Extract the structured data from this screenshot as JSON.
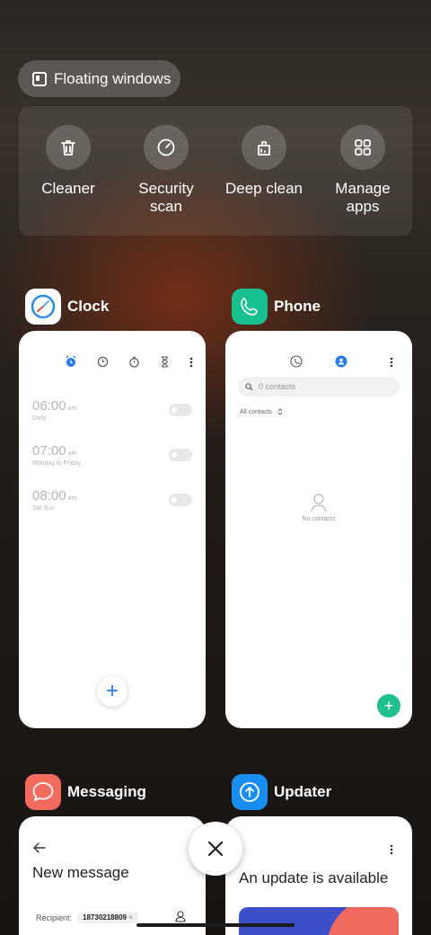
{
  "floating_windows": {
    "label": "Floating windows",
    "icon": "floating-window-icon"
  },
  "tools": [
    {
      "label": "Cleaner",
      "icon": "trash-icon"
    },
    {
      "label": "Security scan",
      "icon": "security-scan-icon"
    },
    {
      "label": "Deep clean",
      "icon": "deep-clean-icon"
    },
    {
      "label": "Manage apps",
      "icon": "apps-grid-icon"
    }
  ],
  "apps": {
    "clock": {
      "name": "Clock",
      "icon_color": "#ffffff",
      "alarms": [
        {
          "time": "06:00",
          "ampm": "am",
          "repeat": "Daily"
        },
        {
          "time": "07:00",
          "ampm": "am",
          "repeat": "Monday to Friday"
        },
        {
          "time": "08:00",
          "ampm": "am",
          "repeat": "Sat Sun"
        }
      ],
      "add": "+"
    },
    "phone": {
      "name": "Phone",
      "icon_color": "#18c08f",
      "search_placeholder": "0 contacts",
      "filter": "All contacts",
      "empty": "No contacts",
      "add": "+"
    },
    "messaging": {
      "name": "Messaging",
      "icon_color": "#f36b5c",
      "title": "New message",
      "recipient_label": "Recipient:",
      "recipient_number": "18730218809",
      "recipient_remove": "×"
    },
    "updater": {
      "name": "Updater",
      "icon_color": "#1a8ef0",
      "title": "An update is available"
    }
  },
  "close": {
    "icon": "close-icon"
  }
}
